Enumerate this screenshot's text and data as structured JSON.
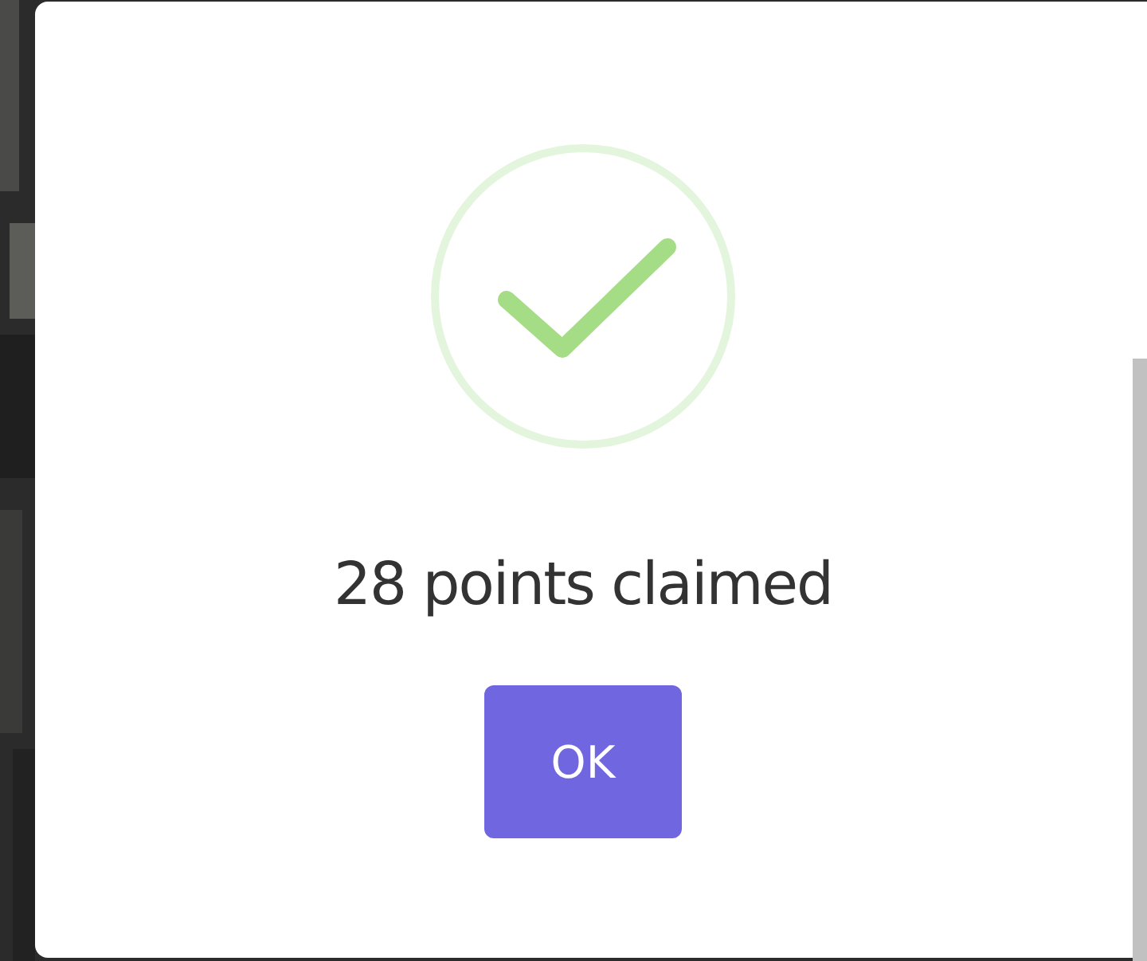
{
  "dialog": {
    "message": "28 points claimed",
    "buttons": [
      {
        "label": "OK"
      }
    ]
  }
}
